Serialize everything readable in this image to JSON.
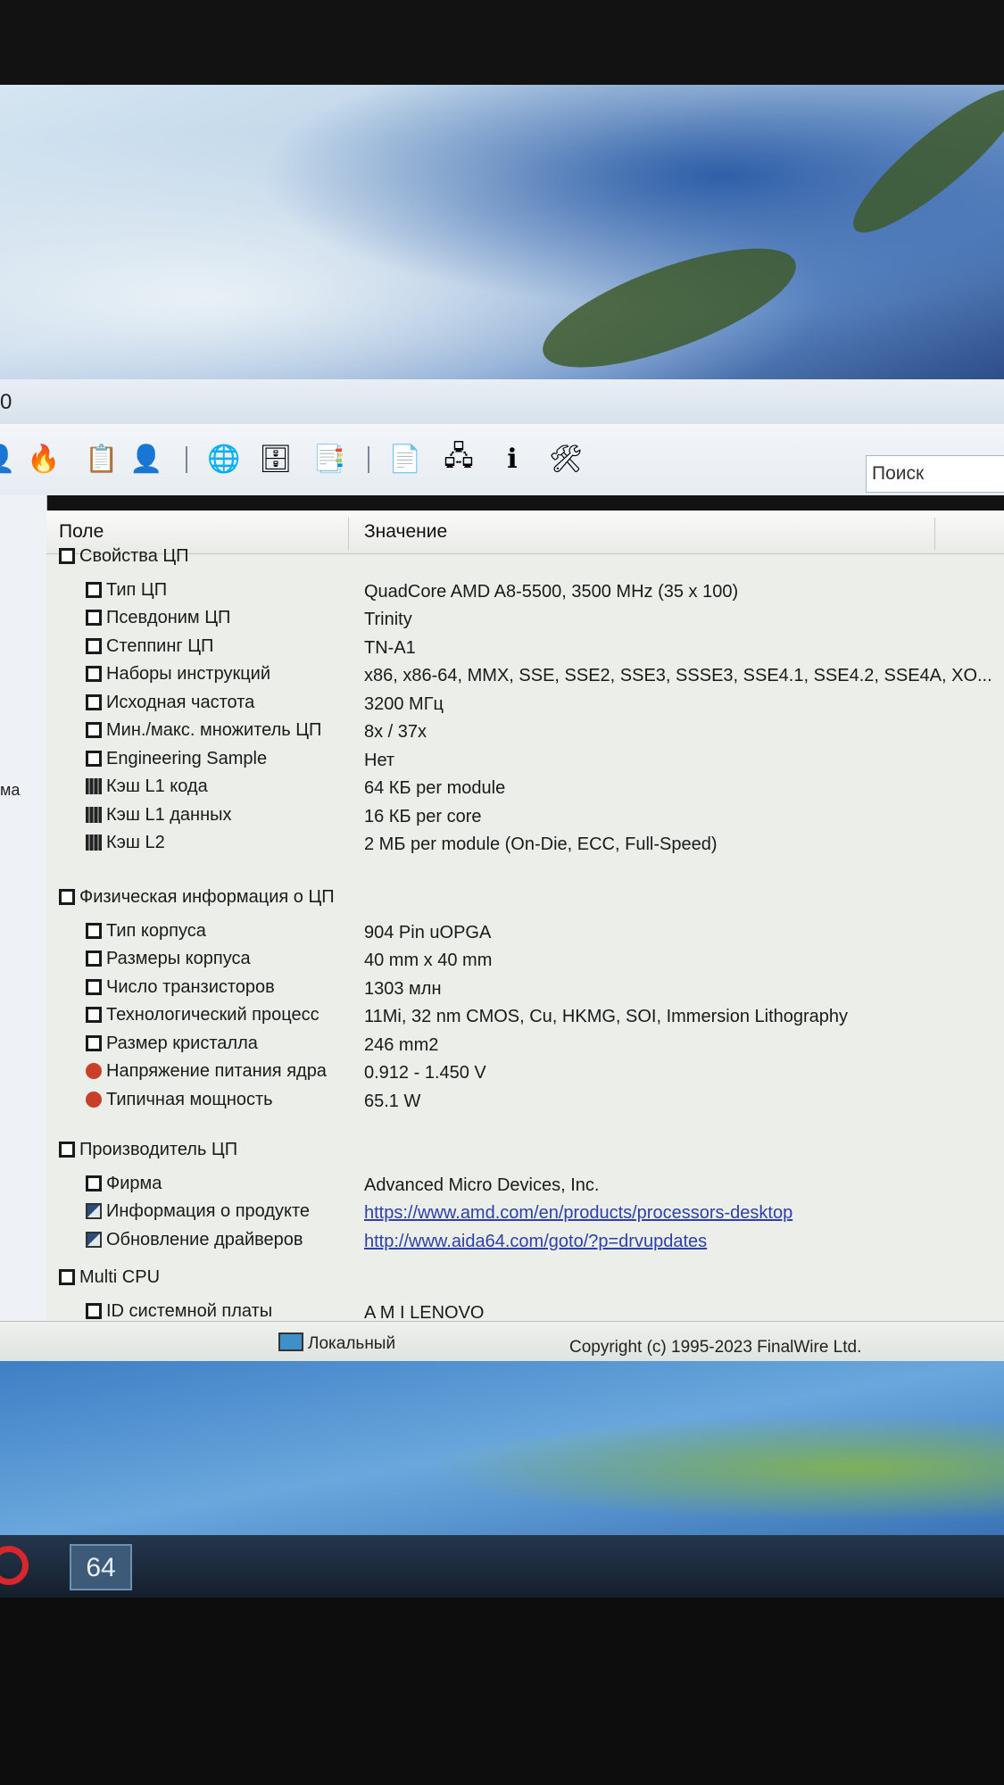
{
  "window": {
    "title_fragment": "0"
  },
  "toolbar": {
    "icons": [
      "user-icon",
      "fire-icon",
      "task-scheduler-icon",
      "person-icon",
      "globe-icon",
      "database-icon",
      "report-icon",
      "system-report-icon",
      "network-icon",
      "info-icon",
      "tools-icon"
    ],
    "search_placeholder": "Поиск"
  },
  "left_pane": {
    "label_fragment": "ма"
  },
  "table": {
    "headers": {
      "field": "Поле",
      "value": "Значение"
    },
    "groups": [
      {
        "title": "Свойства ЦП",
        "rows": [
          {
            "icon": "box",
            "field": "Тип ЦП",
            "value": "QuadCore AMD A8-5500, 3500 MHz (35 x 100)"
          },
          {
            "icon": "box",
            "field": "Псевдоним ЦП",
            "value": "Trinity"
          },
          {
            "icon": "box",
            "field": "Степпинг ЦП",
            "value": "TN-A1"
          },
          {
            "icon": "box",
            "field": "Наборы инструкций",
            "value": "x86, x86-64, MMX, SSE, SSE2, SSE3, SSSE3, SSE4.1, SSE4.2, SSE4A, XO..."
          },
          {
            "icon": "box",
            "field": "Исходная частота",
            "value": "3200 МГц"
          },
          {
            "icon": "box",
            "field": "Мин./макс. множитель ЦП",
            "value": "8x / 37x"
          },
          {
            "icon": "box",
            "field": "Engineering Sample",
            "value": "Нет"
          },
          {
            "icon": "chip",
            "field": "Кэш L1 кода",
            "value": "64 КБ per module"
          },
          {
            "icon": "chip",
            "field": "Кэш L1 данных",
            "value": "16 КБ per core"
          },
          {
            "icon": "chip",
            "field": "Кэш L2",
            "value": "2 МБ per module  (On-Die, ECC, Full-Speed)"
          }
        ]
      },
      {
        "title": "Физическая информация о ЦП",
        "rows": [
          {
            "icon": "box",
            "field": "Тип корпуса",
            "value": "904 Pin uOPGA"
          },
          {
            "icon": "box",
            "field": "Размеры корпуса",
            "value": "40 mm x 40 mm"
          },
          {
            "icon": "box",
            "field": "Число транзисторов",
            "value": "1303 млн"
          },
          {
            "icon": "box",
            "field": "Технологический процесс",
            "value": "11Mi, 32 nm CMOS, Cu, HKMG, SOI, Immersion Lithography"
          },
          {
            "icon": "box",
            "field": "Размер кристалла",
            "value": "246 mm2"
          },
          {
            "icon": "volt",
            "field": "Напряжение питания ядра",
            "value": "0.912 - 1.450 V"
          },
          {
            "icon": "volt",
            "field": "Типичная мощность",
            "value": "65.1 W"
          }
        ]
      },
      {
        "title": "Производитель ЦП",
        "rows": [
          {
            "icon": "box",
            "field": "Фирма",
            "value": "Advanced Micro Devices, Inc."
          },
          {
            "icon": "link",
            "field": "Информация о продукте",
            "value": "https://www.amd.com/en/products/processors-desktop"
          },
          {
            "icon": "link",
            "field": "Обновление драйверов",
            "value": "http://www.aida64.com/goto/?p=drvupdates"
          }
        ]
      },
      {
        "title": "Multi CPU",
        "rows": [
          {
            "icon": "box",
            "field": "ID системной платы",
            "value": "A M I LENOVO"
          }
        ]
      }
    ]
  },
  "statusbar": {
    "connection": "Локальный",
    "copyright": "Copyright (c) 1995-2023 FinalWire Ltd."
  },
  "taskbar": {
    "app_badge": "64"
  }
}
